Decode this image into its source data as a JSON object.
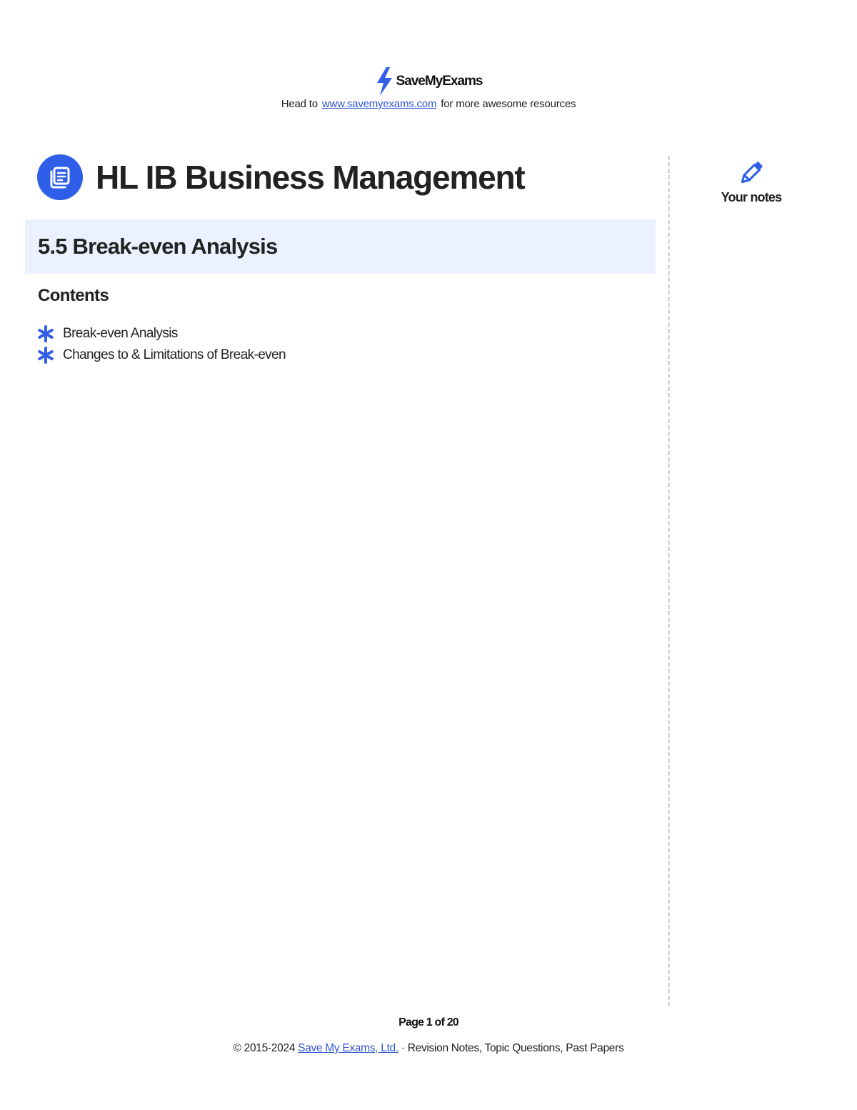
{
  "header": {
    "brand_name": "SaveMyExams",
    "tagline_prefix": "Head to",
    "tagline_link": "www.savemyexams.com",
    "tagline_suffix": "for more awesome resources"
  },
  "document": {
    "subject_title": "HL IB Business Management",
    "topic_title": "5.5 Break-even Analysis",
    "contents_heading": "Contents",
    "contents_items": [
      "Break-even Analysis",
      "Changes to & Limitations of Break-even"
    ]
  },
  "notes": {
    "label": "Your notes"
  },
  "footer": {
    "page_label": "Page 1 of 20",
    "copyright_prefix": "© 2015-2024",
    "copyright_link": "Save My Exams, Ltd.",
    "copyright_suffix": "· Revision Notes, Topic Questions, Past Papers"
  },
  "colors": {
    "accent": "#2f5ee8",
    "topic_band": "#ebf1fe",
    "link": "#3056d3",
    "divider": "#d9d9d9"
  },
  "icons": {
    "brand": "lightning-bolt-icon",
    "subject": "book-icon",
    "list_bullet": "asterisk-star-icon",
    "notes": "pencil-icon"
  }
}
